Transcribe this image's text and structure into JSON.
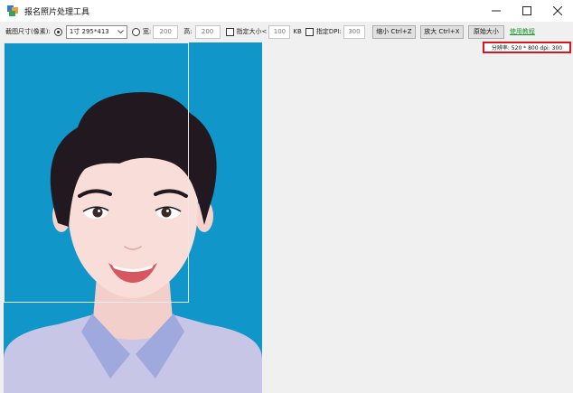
{
  "window": {
    "title": "报名照片处理工具",
    "controls": [
      "minimize-icon",
      "maximize-icon",
      "close-icon"
    ]
  },
  "toolbar": {
    "crop_size_label": "截图尺寸(像素):",
    "preset_select": {
      "value": "1寸 295*413",
      "checked": true
    },
    "custom": {
      "checked": false,
      "width_label": "宽:",
      "width_value": "200",
      "height_label": "高:",
      "height_value": "200"
    },
    "size_limit": {
      "checked": false,
      "label": "指定大小<",
      "value": "100",
      "unit": "KB"
    },
    "dpi": {
      "checked": false,
      "label": "指定DPI:",
      "value": "300"
    },
    "shrink_button": "缩小 Ctrl+Z",
    "enlarge_button": "放大 Ctrl+X",
    "original_button": "原始大小",
    "help_link": "使用教程"
  },
  "status": {
    "resolution_text": "分辨率: 520 * 800 dpi: 300"
  },
  "colors": {
    "photo_background": "#1196c9",
    "hair": "#21191f",
    "skin": "#f9ddd8",
    "shirt": "#c7c6e6",
    "collar": "#9fa9dd",
    "highlight_border": "#d9161c",
    "link": "#1a9a2a"
  }
}
